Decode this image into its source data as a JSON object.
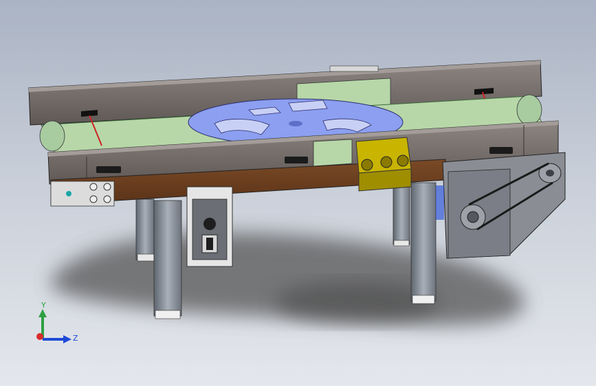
{
  "colors": {
    "background_top": "#aab3c4",
    "background_bottom": "#e4e7ec",
    "frame_rail": "#77706c",
    "belt": "#b7d7a8",
    "turntable": "#8c9ff0",
    "drive_block": "#c9b400",
    "motor_housing": "#8a8d94",
    "leg": "#7d848f",
    "shadow": "#565656",
    "axis_y": "#2ea043",
    "axis_z": "#1e4ad8",
    "axis_x": "#d92b2b"
  },
  "view_triad": {
    "y_label": "Y",
    "z_label": "Z"
  }
}
